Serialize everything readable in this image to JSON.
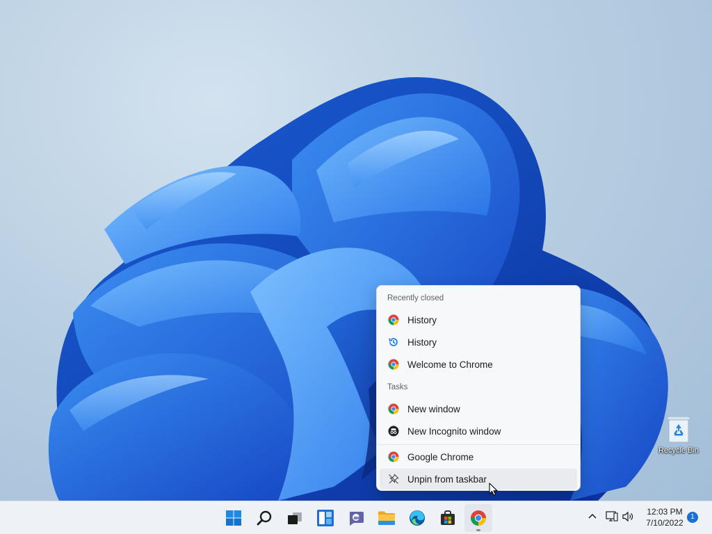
{
  "desktop": {
    "recycle_bin_label": "Recycle Bin"
  },
  "jump_list": {
    "recently_closed_header": "Recently closed",
    "recently_closed": [
      {
        "label": "History",
        "icon": "chrome-icon"
      },
      {
        "label": "History",
        "icon": "history-icon"
      },
      {
        "label": "Welcome to Chrome",
        "icon": "chrome-icon"
      }
    ],
    "tasks_header": "Tasks",
    "tasks": [
      {
        "label": "New window",
        "icon": "chrome-icon"
      },
      {
        "label": "New Incognito window",
        "icon": "incognito-icon"
      }
    ],
    "app": [
      {
        "label": "Google Chrome",
        "icon": "chrome-icon"
      },
      {
        "label": "Unpin from taskbar",
        "icon": "unpin-icon"
      }
    ]
  },
  "taskbar": {
    "apps": [
      {
        "name": "start",
        "icon": "windows-logo-icon"
      },
      {
        "name": "search",
        "icon": "search-icon"
      },
      {
        "name": "task-view",
        "icon": "task-view-icon"
      },
      {
        "name": "widgets",
        "icon": "widgets-icon"
      },
      {
        "name": "chat",
        "icon": "teams-chat-icon"
      },
      {
        "name": "file-explorer",
        "icon": "folder-icon"
      },
      {
        "name": "edge",
        "icon": "edge-icon"
      },
      {
        "name": "store",
        "icon": "store-icon"
      },
      {
        "name": "chrome",
        "icon": "chrome-icon",
        "active": true
      }
    ],
    "tray": {
      "time": "12:03 PM",
      "date": "7/10/2022",
      "notification_count": "1"
    }
  },
  "colors": {
    "accent": "#1a6fd8",
    "chrome_red": "#db4437",
    "chrome_yellow": "#f4c20d",
    "chrome_green": "#0f9d58",
    "chrome_blue": "#4285f4"
  }
}
